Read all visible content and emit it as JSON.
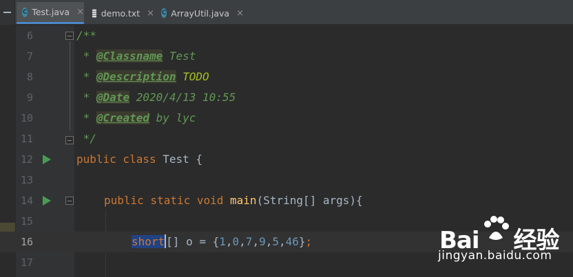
{
  "tabs": [
    {
      "label": "Test.java",
      "type": "java",
      "active": true
    },
    {
      "label": "demo.txt",
      "type": "txt",
      "active": false
    },
    {
      "label": "ArrayUtil.java",
      "type": "java",
      "active": false
    }
  ],
  "tab_icon_letter": "C",
  "tab_close_glyph": "×",
  "lines": [
    {
      "num": "6"
    },
    {
      "num": "7"
    },
    {
      "num": "8"
    },
    {
      "num": "9"
    },
    {
      "num": "10"
    },
    {
      "num": "11"
    },
    {
      "num": "12"
    },
    {
      "num": "13"
    },
    {
      "num": "14"
    },
    {
      "num": "15"
    },
    {
      "num": "16"
    },
    {
      "num": "17"
    }
  ],
  "code": {
    "l6_open": "/**",
    "l7_star": " * ",
    "l7_tag": "@Classname",
    "l7_val": " Test",
    "l8_star": " * ",
    "l8_tag": "@Description",
    "l8_val": " TODO",
    "l9_star": " * ",
    "l9_tag": "@Date",
    "l9_val": " 2020/4/13 10:55",
    "l10_star": " * ",
    "l10_tag": "@Created",
    "l10_val": " by lyc",
    "l11_close": " */",
    "l12_kw": "public class",
    "l12_rest": " Test {",
    "l14_kw": "public static void",
    "l14_fn": "main",
    "l14_rest": "(String[] args){",
    "l16_sel": "short",
    "l16_rest": "[] o = {",
    "l16_nums": [
      "1",
      "0",
      "7",
      "9",
      "5",
      "46"
    ],
    "l16_comma": ",",
    "l16_close": "}",
    "l16_semi": ";"
  },
  "watermark": {
    "logo_text": "Bai",
    "logo_tail": "经验",
    "url": "jingyan.baidu.com"
  },
  "colors": {
    "editor_bg": "#2b2b2b",
    "keyword": "#cc7832",
    "comment": "#629755",
    "number": "#6897bb",
    "function": "#ffc66d",
    "selection": "#214283"
  }
}
